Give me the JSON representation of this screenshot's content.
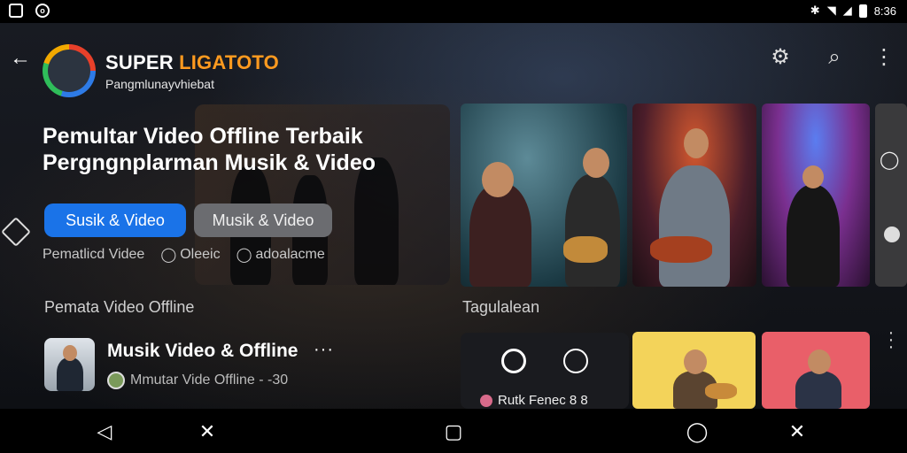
{
  "status_bar": {
    "time": "8:36",
    "left_icons": [
      "sim-icon",
      "app-notification-icon"
    ],
    "right_icons": [
      "bluetooth-icon",
      "wifi-icon",
      "signal-icon",
      "battery-icon"
    ]
  },
  "header": {
    "brand_part1": "SUPER ",
    "brand_part2": "LIGATOTO",
    "tagline": "Pangmlunayvhiebat",
    "icons": [
      "back-arrow-icon",
      "settings-icon",
      "search-icon",
      "more-vertical-icon"
    ]
  },
  "hero": {
    "headline_line1": "Pemultar Video Offline Terbaik",
    "headline_line2": "Pergngnplarman Musik & Video",
    "primary_button": "Susik & Video",
    "secondary_button": "Musik & Video",
    "meta_items": [
      "Pematlicd Videe",
      "Oleeic",
      "adoalacme"
    ]
  },
  "sections": {
    "left_title": "Pemata Video Offline",
    "right_title": "Tagulalean"
  },
  "list_item": {
    "title": "Musik Video & Offline",
    "more": "···",
    "subtitle": "Mmutar Vide Offline - -30"
  },
  "panel": {
    "text": "Rutk Fenec 8 8"
  },
  "colors": {
    "accent": "#1a73e8",
    "brand_orange": "#ff9a1f",
    "background": "#0d0f14"
  }
}
